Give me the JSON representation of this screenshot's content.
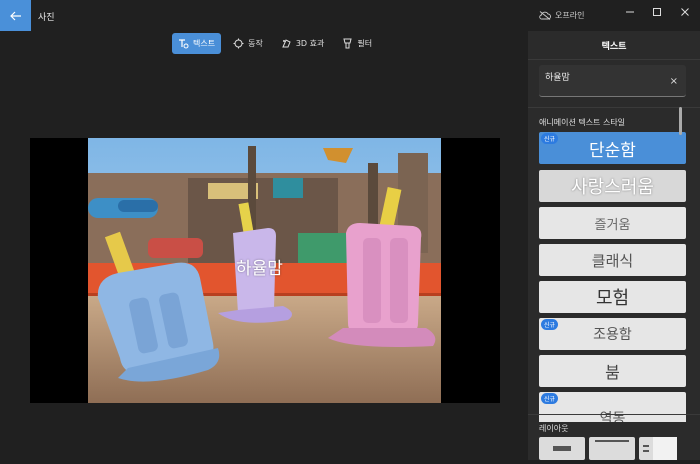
{
  "app": {
    "title": "사진",
    "offline_label": "오프라인"
  },
  "toolbar": {
    "tools": [
      {
        "label": "텍스트",
        "icon": "text-icon",
        "active": true
      },
      {
        "label": "동작",
        "icon": "motion-icon",
        "active": false
      },
      {
        "label": "3D 효과",
        "icon": "3d-effects-icon",
        "active": false
      },
      {
        "label": "필터",
        "icon": "filter-icon",
        "active": false
      }
    ]
  },
  "canvas": {
    "overlay_text": "하율맘"
  },
  "panel": {
    "title": "텍스트",
    "input": {
      "value": "하율맘",
      "clear_glyph": "×"
    },
    "styles_label": "애니메이션 텍스트 스타일",
    "styles": [
      {
        "label": "단순함",
        "badge": "신규",
        "selected": true
      },
      {
        "label": "사랑스러움",
        "badge": "",
        "selected": false
      },
      {
        "label": "즐거움",
        "badge": "",
        "selected": false
      },
      {
        "label": "클래식",
        "badge": "",
        "selected": false
      },
      {
        "label": "모험",
        "badge": "",
        "selected": false
      },
      {
        "label": "조용함",
        "badge": "신규",
        "selected": false
      },
      {
        "label": "붐",
        "badge": "",
        "selected": false
      },
      {
        "label": "역동",
        "badge": "신규",
        "selected": false
      }
    ],
    "layout_label": "레이아웃"
  },
  "colors": {
    "accent": "#4a8fd8",
    "badge": "#2d7be0",
    "panel_bg": "#2b2b2b",
    "app_bg": "#202020"
  }
}
